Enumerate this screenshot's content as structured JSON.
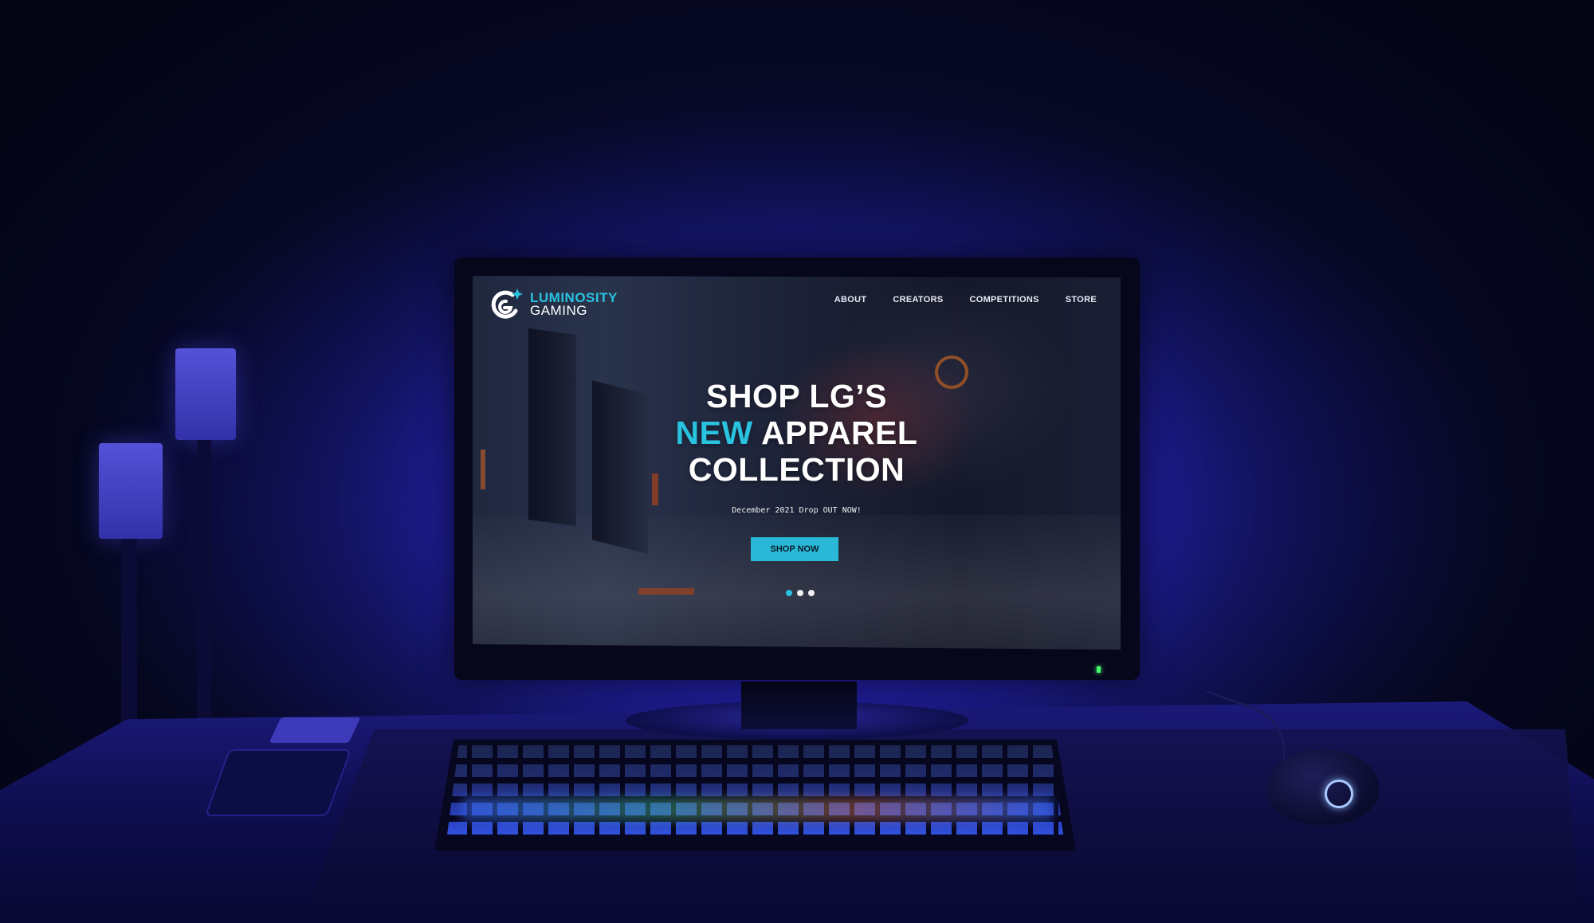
{
  "site": {
    "logo": {
      "line1": "LUMINOSITY",
      "line2": "GAMING",
      "icon": "lg-logo-icon"
    },
    "nav": {
      "items": [
        {
          "label": "ABOUT"
        },
        {
          "label": "CREATORS"
        },
        {
          "label": "COMPETITIONS"
        },
        {
          "label": "STORE"
        }
      ]
    },
    "hero": {
      "title_line1": "SHOP LG’S",
      "title_accent": "NEW",
      "title_line2_rest": " APPAREL",
      "title_line3": "COLLECTION",
      "subtitle": "December 2021 Drop OUT NOW!",
      "cta_label": "SHOP NOW",
      "carousel_dots": 3,
      "active_dot": 1
    }
  },
  "colors": {
    "accent": "#29c3e0",
    "button": "#29b8d6",
    "text": "#ffffff"
  }
}
